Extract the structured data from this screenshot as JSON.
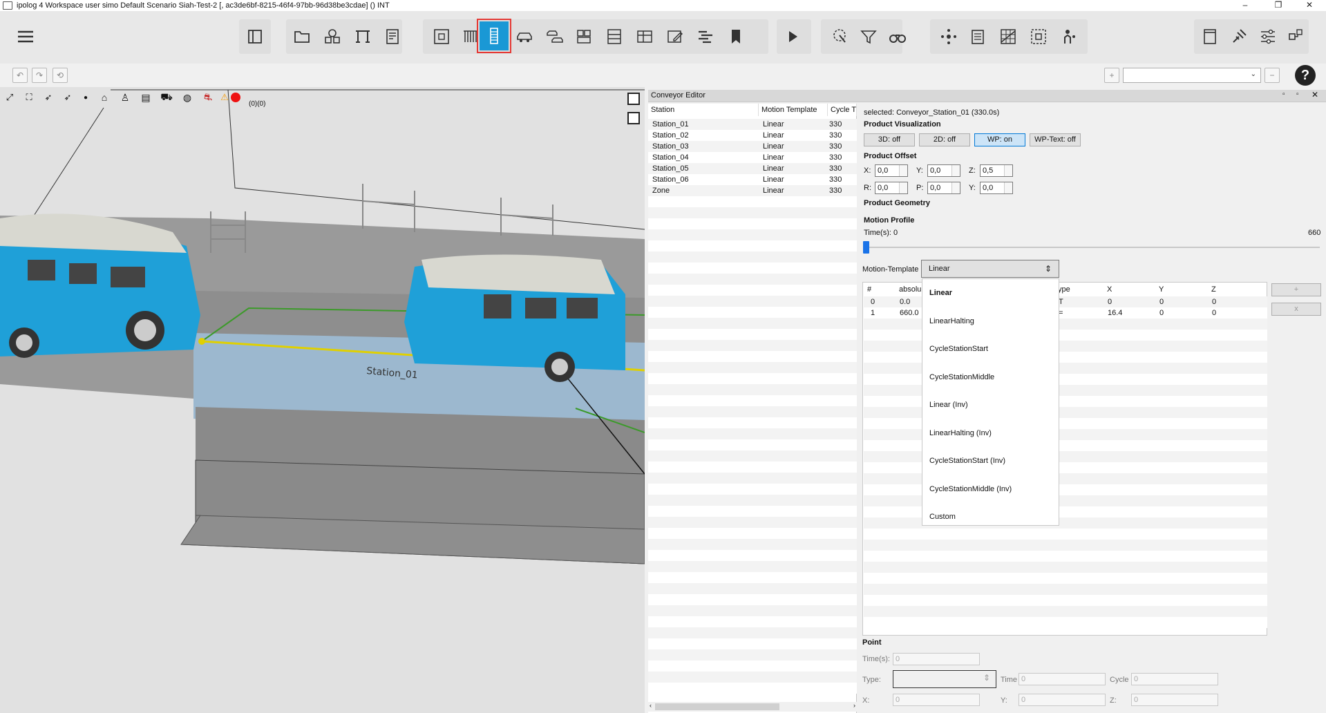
{
  "window": {
    "title": "ipolog 4 Workspace user simo Default Scenario Siah-Test-2 [, ac3de6bf-8215-46f4-97bb-96d38be3cdae] () INT",
    "minimize": "–",
    "maximize": "❐",
    "close": "✕"
  },
  "toolbar": {
    "active_tool": "conveyor-tool"
  },
  "viewport": {
    "warning_counts": "(0)(0)",
    "station_label": "Station_01"
  },
  "conveyor_editor": {
    "title": "Conveyor Editor",
    "columns": [
      "Station",
      "Motion Template",
      "Cycle Tir"
    ],
    "stations": [
      {
        "name": "Station_01",
        "template": "Linear",
        "cycle": "330"
      },
      {
        "name": "Station_02",
        "template": "Linear",
        "cycle": "330"
      },
      {
        "name": "Station_03",
        "template": "Linear",
        "cycle": "330"
      },
      {
        "name": "Station_04",
        "template": "Linear",
        "cycle": "330"
      },
      {
        "name": "Station_05",
        "template": "Linear",
        "cycle": "330"
      },
      {
        "name": "Station_06",
        "template": "Linear",
        "cycle": "330"
      },
      {
        "name": "Zone",
        "template": "Linear",
        "cycle": "330"
      }
    ]
  },
  "detail": {
    "selected": "selected: Conveyor_Station_01 (330.0s)",
    "product_visualization": "Product Visualization",
    "vis_buttons": [
      "3D: off",
      "2D: off",
      "WP: on",
      "WP-Text: off"
    ],
    "product_offset": "Product Offset",
    "offset_fields": [
      {
        "label": "X:",
        "value": "0,0"
      },
      {
        "label": "Y:",
        "value": "0,0"
      },
      {
        "label": "Z:",
        "value": "0,5"
      },
      {
        "label": "R:",
        "value": "0,0"
      },
      {
        "label": "P:",
        "value": "0,0"
      },
      {
        "label": "Y:",
        "value": "0,0"
      }
    ],
    "product_geometry": "Product Geometry",
    "motion_profile": "Motion Profile",
    "time_label": "Time(s): 0",
    "time_max": "660",
    "time_fraction": 0,
    "motion_template_label": "Motion-Template",
    "motion_template_value": "Linear",
    "template_options": [
      "Linear",
      "LinearHalting",
      "CycleStationStart",
      "CycleStationMiddle",
      "Linear (Inv)",
      "LinearHalting (Inv)",
      "CycleStationStart (Inv)",
      "CycleStationMiddle (Inv)",
      "Custom"
    ],
    "points_columns": [
      "#",
      "absolu",
      "ype",
      "X",
      "Y",
      "Z"
    ],
    "points": [
      {
        "idx": "0",
        "abs": "0.0",
        "type": "T",
        "x": "0",
        "y": "0",
        "z": "0"
      },
      {
        "idx": "1",
        "abs": "660.0",
        "type": "=",
        "x": "16.4",
        "y": "0",
        "z": "0"
      }
    ],
    "add": "+",
    "remove": "x",
    "point_section": "Point",
    "point_fields": {
      "time_label": "Time(s):",
      "time": "0",
      "type_label": "Type:",
      "time2_label": "Time",
      "time2": "0",
      "cycle_label": "Cycle",
      "cycle": "0",
      "x_label": "X:",
      "x": "0",
      "y_label": "Y:",
      "y": "0",
      "z_label": "Z:",
      "z": "0"
    }
  }
}
